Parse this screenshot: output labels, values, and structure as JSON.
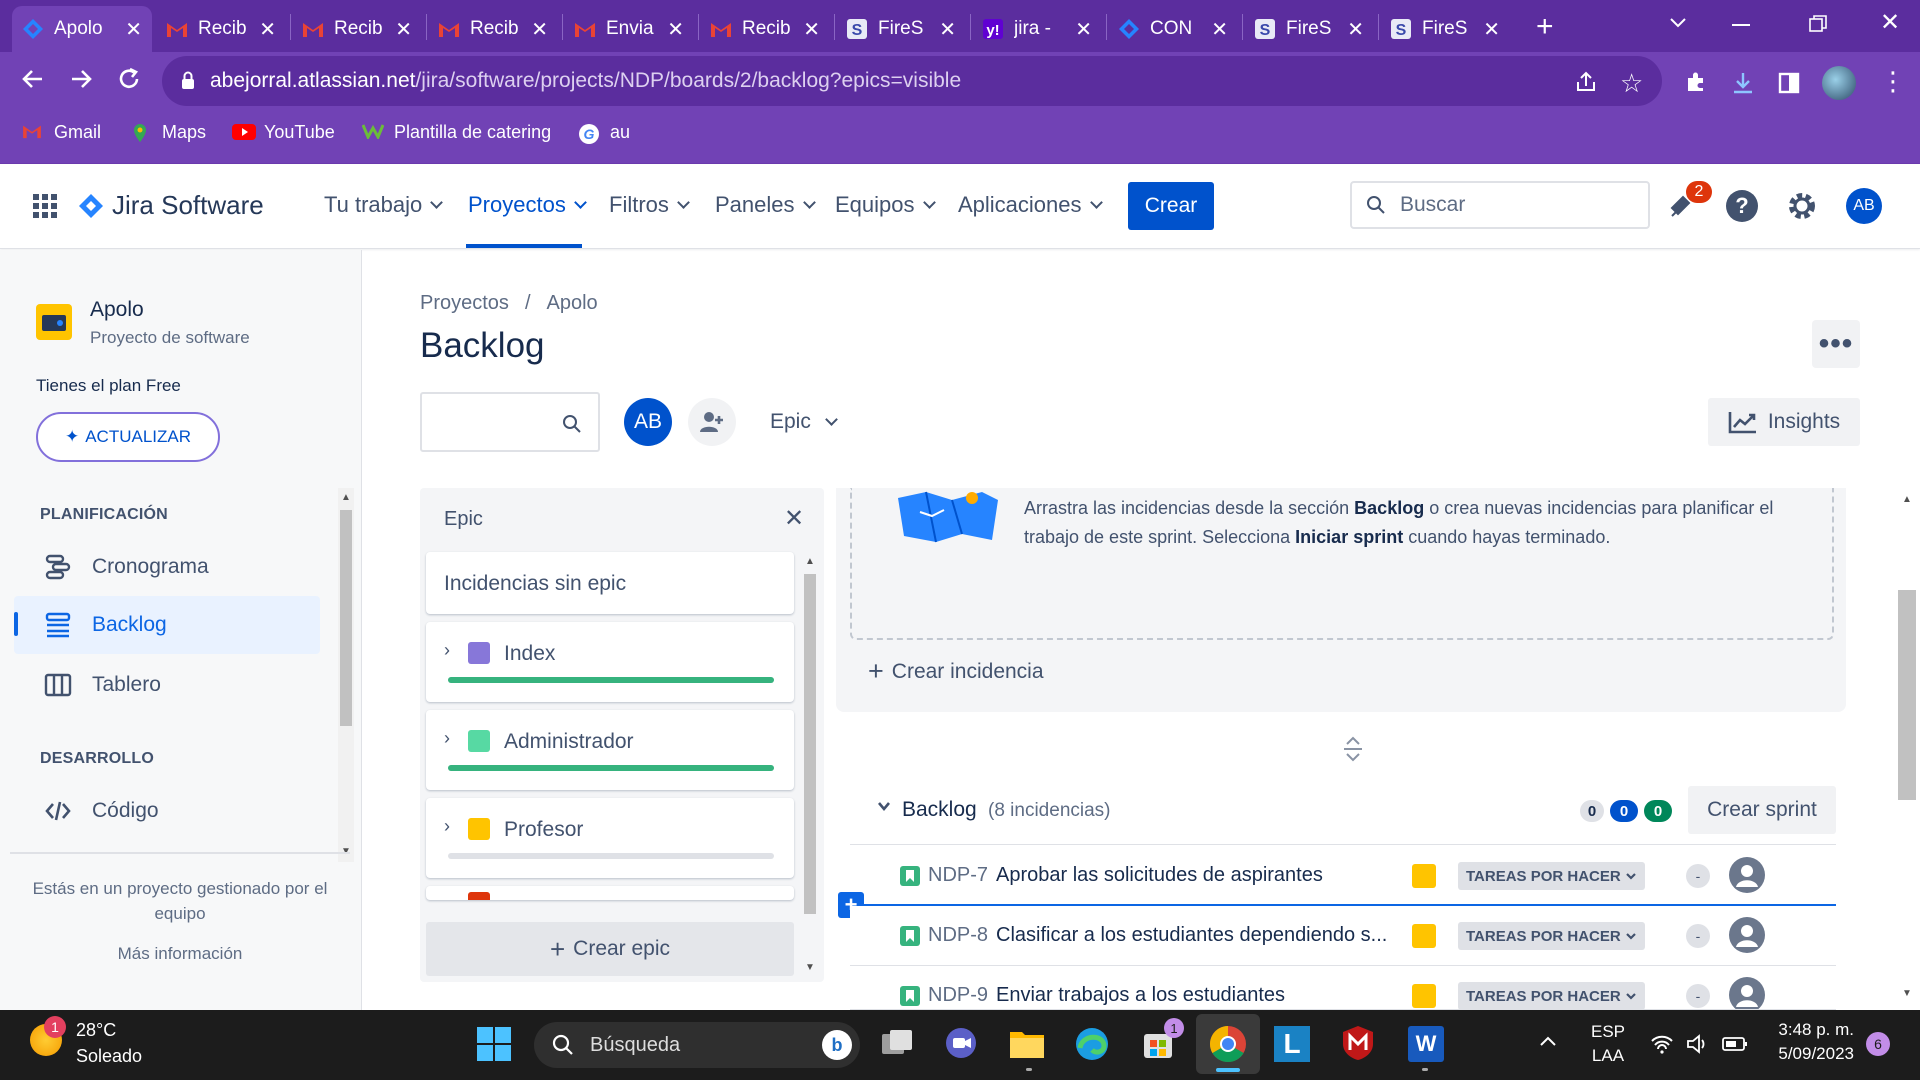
{
  "browser": {
    "tabs": [
      {
        "label": "Apolo",
        "icon": "jira-icon",
        "active": true
      },
      {
        "label": "Recib",
        "icon": "gmail-icon"
      },
      {
        "label": "Recib",
        "icon": "gmail-icon"
      },
      {
        "label": "Recib",
        "icon": "gmail-icon"
      },
      {
        "label": "Envia",
        "icon": "gmail-icon"
      },
      {
        "label": "Recib",
        "icon": "gmail-icon"
      },
      {
        "label": "FireS",
        "icon": "firestore-icon"
      },
      {
        "label": "jira -",
        "icon": "yahoo-icon"
      },
      {
        "label": "CON",
        "icon": "jira-icon"
      },
      {
        "label": "FireS",
        "icon": "firestore-icon"
      },
      {
        "label": "FireS",
        "icon": "firestore-icon"
      }
    ],
    "url_host": "abejorral.atlassian.net",
    "url_path": "/jira/software/projects/NDP/boards/2/backlog?epics=visible",
    "bookmarks": [
      "Gmail",
      "Maps",
      "YouTube",
      "Plantilla de catering",
      "au"
    ]
  },
  "jira_nav": {
    "product": "Jira Software",
    "items": [
      "Tu trabajo",
      "Proyectos",
      "Filtros",
      "Paneles",
      "Equipos",
      "Aplicaciones"
    ],
    "create": "Crear",
    "search_placeholder": "Buscar",
    "notification_count": "2",
    "avatar": "AB"
  },
  "sidebar": {
    "project_name": "Apolo",
    "project_type": "Proyecto de software",
    "plan": "Tienes el plan Free",
    "upgrade": "ACTUALIZAR",
    "planning_header": "PLANIFICACIÓN",
    "planning_items": [
      "Cronograma",
      "Backlog",
      "Tablero"
    ],
    "dev_header": "DESARROLLO",
    "dev_items": [
      "Código"
    ],
    "footer_text": "Estás en un proyecto gestionado por el equipo",
    "more_info": "Más información"
  },
  "main": {
    "breadcrumb": [
      "Proyectos",
      "Apolo"
    ],
    "title": "Backlog",
    "avatar": "AB",
    "epic_filter": "Epic",
    "insights": "Insights"
  },
  "epic_panel": {
    "title": "Epic",
    "no_epic": "Incidencias sin epic",
    "epics": [
      {
        "name": "Index",
        "color": "#8777d9",
        "progress": 1.0
      },
      {
        "name": "Administrador",
        "color": "#57d9a3",
        "progress": 1.0
      },
      {
        "name": "Profesor",
        "color": "#ffc400",
        "progress": 0.0
      }
    ],
    "create_epic": "Crear epic"
  },
  "sprint": {
    "hint_part1": "Arrastra las incidencias desde la sección ",
    "hint_bold1": "Backlog",
    "hint_part2": " o crea nuevas incidencias para planificar el trabajo de este sprint. Selecciona ",
    "hint_bold2": "Iniciar sprint",
    "hint_part3": " cuando hayas terminado.",
    "create_issue": "Crear incidencia"
  },
  "backlog": {
    "title": "Backlog",
    "count": "(8 incidencias)",
    "badges": [
      "0",
      "0",
      "0"
    ],
    "create_sprint": "Crear sprint",
    "issues": [
      {
        "key": "NDP-7",
        "summary": "Aprobar las solicitudes de aspirantes",
        "status": "TAREAS POR HACER",
        "estimate": "-"
      },
      {
        "key": "NDP-8",
        "summary": "Clasificar a los estudiantes dependiendo s...",
        "status": "TAREAS POR HACER",
        "estimate": "-"
      },
      {
        "key": "NDP-9",
        "summary": "Enviar trabajos a los estudiantes",
        "status": "TAREAS POR HACER",
        "estimate": "-"
      }
    ]
  },
  "taskbar": {
    "weather_temp": "28°C",
    "weather_text": "Soleado",
    "weather_badge": "1",
    "search": "Búsqueda",
    "lang1": "ESP",
    "lang2": "LAA",
    "time": "3:48 p. m.",
    "date": "5/09/2023",
    "notif": "6",
    "store_badge": "1"
  },
  "colors": {
    "jira_blue": "#0052cc",
    "chrome_purple": "#7142b5",
    "progress_green": "#36b37e"
  }
}
